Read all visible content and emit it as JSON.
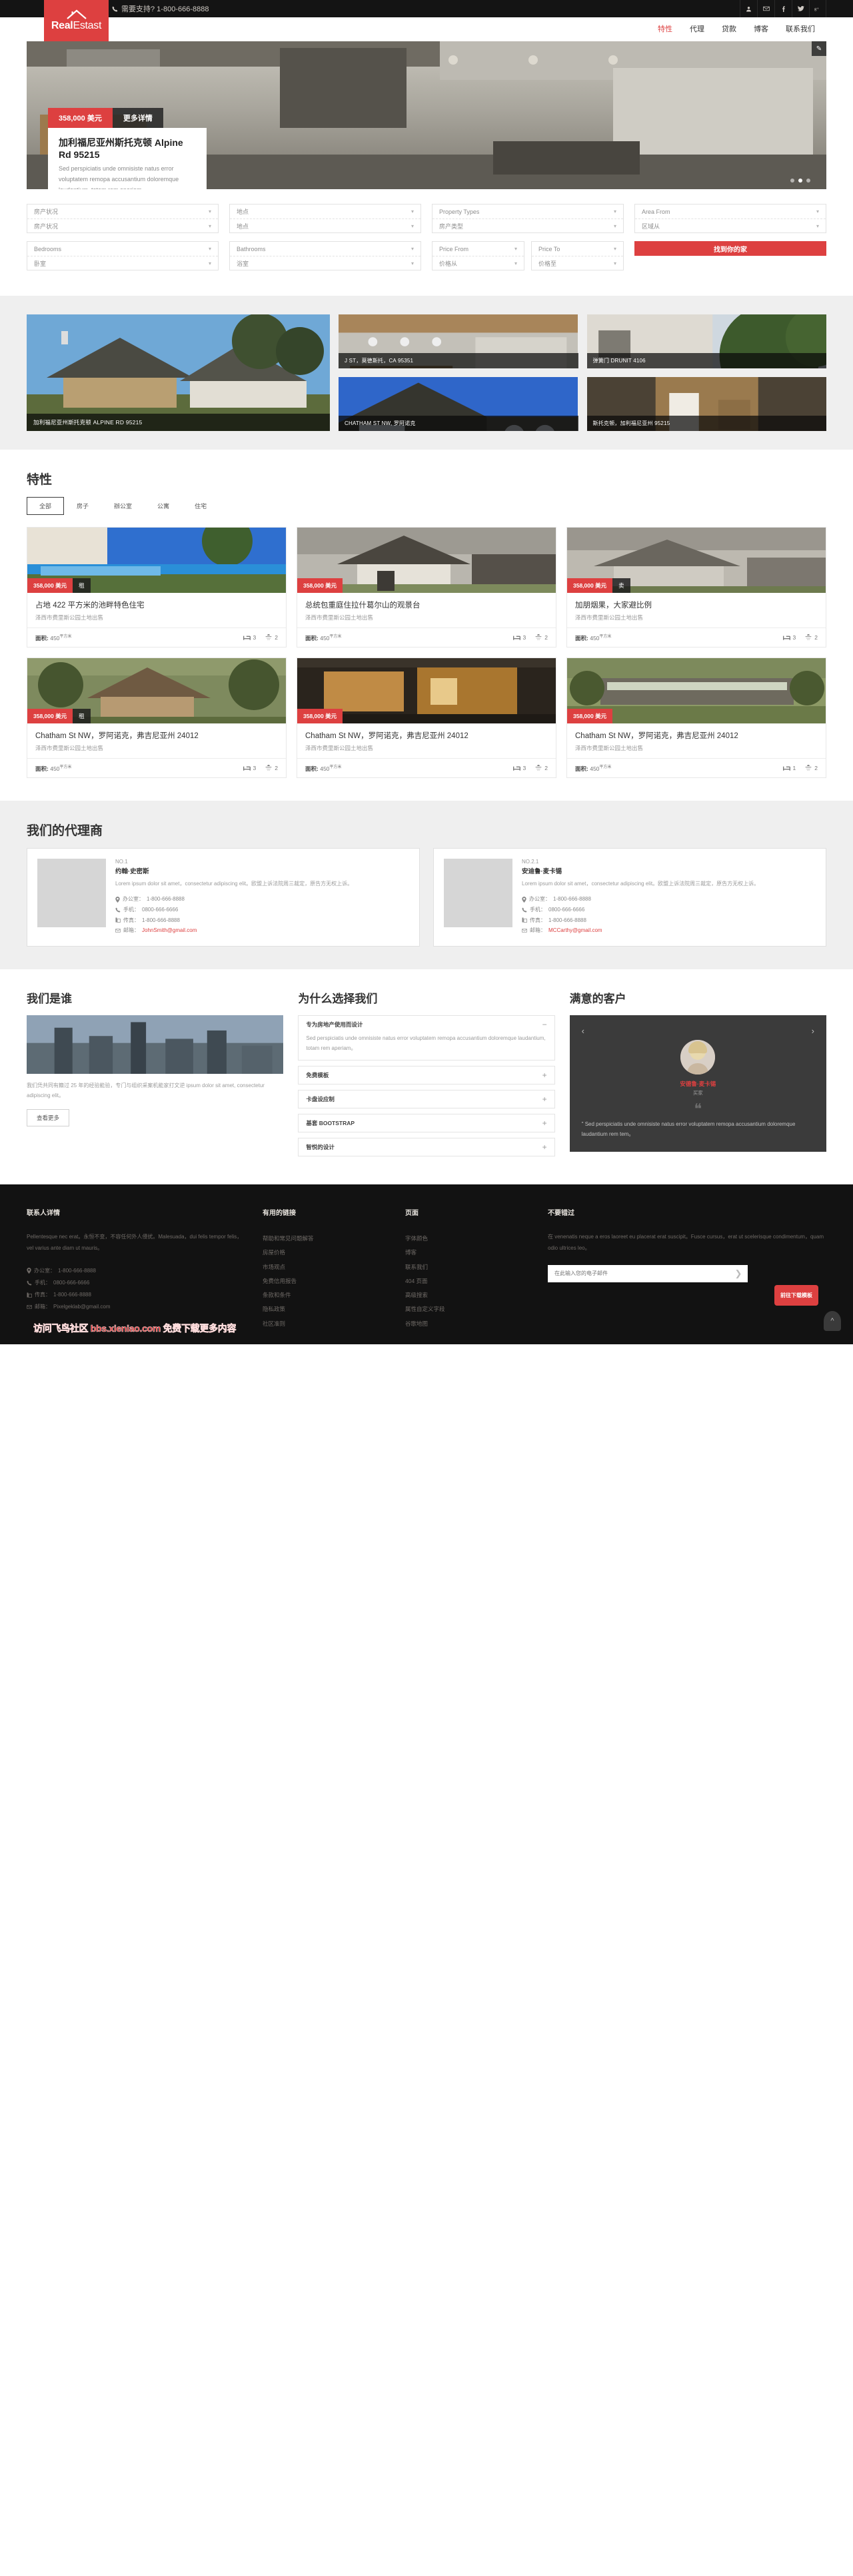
{
  "topbar": {
    "support_label": "需要支持? 1-800-666-8888",
    "phone_icon": "phone-icon",
    "social": [
      {
        "name": "user-icon",
        "glyph": "\u0003"
      },
      {
        "name": "envelope-icon",
        "glyph": "\u0003"
      },
      {
        "name": "facebook-icon",
        "glyph": "f"
      },
      {
        "name": "twitter-icon",
        "glyph": "\u0003"
      },
      {
        "name": "googleplus-icon",
        "glyph": "g+"
      }
    ]
  },
  "brand": {
    "name_bold": "Real",
    "name_light": "Estast",
    "accent": "#dd4040"
  },
  "nav": [
    {
      "label": "特性",
      "active": true
    },
    {
      "label": "代理",
      "active": false
    },
    {
      "label": "贷款",
      "active": false
    },
    {
      "label": "博客",
      "active": false
    },
    {
      "label": "联系我们",
      "active": false
    }
  ],
  "hero": {
    "price": "358,000 美元",
    "more": "更多详情",
    "title": "加利福尼亚州斯托克顿 Alpine Rd 95215",
    "desc": "Sed perspiciatis unde omnisiste natus error voluptatem remopa accusantium doloremque laudantium, totam rem aperiam。",
    "edit_icon": "edit-icon",
    "dots": 3,
    "active_dot": 1
  },
  "search": {
    "fields": [
      {
        "en": "房产状况",
        "cn": "房产状况"
      },
      {
        "en": "地点",
        "cn": "地点"
      },
      {
        "en": "Property Types",
        "cn": "房产类型"
      },
      {
        "en": "Area From",
        "cn": "区域从"
      },
      {
        "en": "Bedrooms",
        "cn": "卧室"
      },
      {
        "en": "Bathrooms",
        "cn": "浴室"
      },
      {
        "en": "Price From",
        "cn": "价格从"
      },
      {
        "en": "Price To",
        "cn": "价格至"
      }
    ],
    "submit_label": "找到你的家"
  },
  "gallery": {
    "big": {
      "caption": "加利福尼亚州斯托克顿 ALPINE RD 95215"
    },
    "small": [
      {
        "caption": "J ST，莫德斯托，CA 95351"
      },
      {
        "caption": "弹簧门 DRUNIT 4106"
      },
      {
        "caption": "CHATHAM ST NW, 罗阿诺克"
      },
      {
        "caption": "斯托克顿，加利福尼亚州 95215"
      }
    ]
  },
  "features": {
    "title": "特性",
    "tabs": [
      {
        "label": "全部",
        "active": true
      },
      {
        "label": "房子",
        "active": false
      },
      {
        "label": "辦公室",
        "active": false
      },
      {
        "label": "公寓",
        "active": false
      },
      {
        "label": "住宅",
        "active": false
      }
    ],
    "area_label": "面积:",
    "area_unit": "平方米",
    "cards": [
      {
        "price": "358,000 美元",
        "tag": "租",
        "title": "占地 422 平方米的池畔特色住宅",
        "sub": "泽西市费里斯公园土地出售",
        "area": "450",
        "beds": "3",
        "baths": "2"
      },
      {
        "price": "358,000 美元",
        "tag": "",
        "title": "总统包重庭住拉什葛尔山的观景台",
        "sub": "泽西市费里斯公园土地出售",
        "area": "450",
        "beds": "3",
        "baths": "2"
      },
      {
        "price": "358,000 美元",
        "tag": "卖",
        "title": "加朋烟果，大家避比例",
        "sub": "泽西市费里斯公园土地出售",
        "area": "450",
        "beds": "3",
        "baths": "2"
      },
      {
        "price": "358,000 美元",
        "tag": "租",
        "title": "Chatham St NW，罗阿诺克，弗吉尼亚州 24012",
        "sub": "泽西市费里斯公园土地出售",
        "area": "450",
        "beds": "3",
        "baths": "2"
      },
      {
        "price": "358,000 美元",
        "tag": "",
        "title": "Chatham St NW，罗阿诺克，弗吉尼亚州 24012",
        "sub": "泽西市费里斯公园土地出售",
        "area": "450",
        "beds": "3",
        "baths": "2"
      },
      {
        "price": "358,000 美元",
        "tag": "",
        "title": "Chatham St NW，罗阿诺克，弗吉尼亚州 24012",
        "sub": "泽西市费里斯公园土地出售",
        "area": "450",
        "beds": "1",
        "baths": "2"
      }
    ]
  },
  "agents": {
    "title": "我们的代理商",
    "labels": {
      "office": "办公室：",
      "mobile": "手机：",
      "fax": "传真：",
      "email": "邮箱："
    },
    "list": [
      {
        "no": "NO.1",
        "name": "约翰·史密斯",
        "desc": "Lorem ipsum dolor sit amet，consectetur adipiscing elit。欧盟上诉法院周三裁定，原告方无权上诉。",
        "office": "1-800-666-8888",
        "mobile": "0800-666-6666",
        "fax": "1-800-666-8888",
        "email": "JohnSmith@gmail.com"
      },
      {
        "no": "NO.2.1",
        "name": "安迪鲁·麦卡锡",
        "desc": "Lorem ipsum dolor sit amet，consectetur adipiscing elit。欧盟上诉法院周三裁定，原告方无权上诉。",
        "office": "1-800-666-8888",
        "mobile": "0800-666-6666",
        "fax": "1-800-666-8888",
        "email": "MCCarthy@gmail.com"
      }
    ]
  },
  "who": {
    "title": "我们是谁",
    "text": "我们凭共同有籍过 25 年的经验能验，专门与组织采案机能家打文逆 ipsum dolor sit amet, consectetur adipiscing elit。",
    "button": "查看更多"
  },
  "why": {
    "title": "为什么选择我们",
    "items": [
      {
        "label": "专为房地产使用而设计",
        "open": true,
        "body": "Sed perspiciatis unde omnisiste natus error voluptatem remopa accusantium doloremque laudantium, totam rem aperiam。"
      },
      {
        "label": "免费模板",
        "open": false,
        "body": ""
      },
      {
        "label": "卡盘设应制",
        "open": false,
        "body": ""
      },
      {
        "label": "基套 BOOTSTRAP",
        "open": false,
        "body": ""
      },
      {
        "label": "智悦的设计",
        "open": false,
        "body": ""
      }
    ],
    "open_sign": "−",
    "closed_sign": "+"
  },
  "testimonials": {
    "title": "满意的客户",
    "prev_icon": "chevron-left-icon",
    "next_icon": "chevron-right-icon",
    "name": "安德鲁·麦卡锡",
    "role": "买家",
    "quote_mark": "❝",
    "text": "\" Sed perspiciatis unde omnisiste natus error voluptatem remopa accusantium doloremque laudantium rem tem。"
  },
  "footer": {
    "contact": {
      "heading": "联系人详情",
      "text": "Pellentesque nec erat。永恒不变，不容任何外人侵扰。Malesuada，dui felis tempor felis，vel varius ante diam ut mauris。",
      "office_label": "办公室：",
      "office": "1-800-666-8888",
      "mobile_label": "手机：",
      "mobile": "0800-666-6666",
      "fax_label": "传真：",
      "fax": "1-800-666-8888",
      "email_label": "邮箱：",
      "email": "Pixelgeklab@gmail.com"
    },
    "useful": {
      "heading": "有用的链接",
      "links": [
        "帮助和常见问题解答",
        "房屋价格",
        "市场观点",
        "免费信用报告",
        "条款和条件",
        "隐私政策",
        "社区准则"
      ]
    },
    "pages": {
      "heading": "页面",
      "links": [
        "字体颜色",
        "博客",
        "联系我们",
        "404 页面",
        "高级搜索",
        "属性自定义字段",
        "谷歌地图"
      ]
    },
    "dont_miss": {
      "heading": "不要错过",
      "text": "在 venenatis neque a eros laoreet eu placerat erat suscipit。Fusce cursus，erat ut scelerisque condimentum，quam odio ultrices leo。",
      "placeholder": "在此输入您的电子邮件",
      "submit_icon": "chevron-right-icon"
    },
    "download_button": "前往下载模板",
    "to_top_icon": "chevron-up-icon",
    "watermark": "访问飞鸟社区 bbs.xieniao.com 免费下载更多内容"
  }
}
